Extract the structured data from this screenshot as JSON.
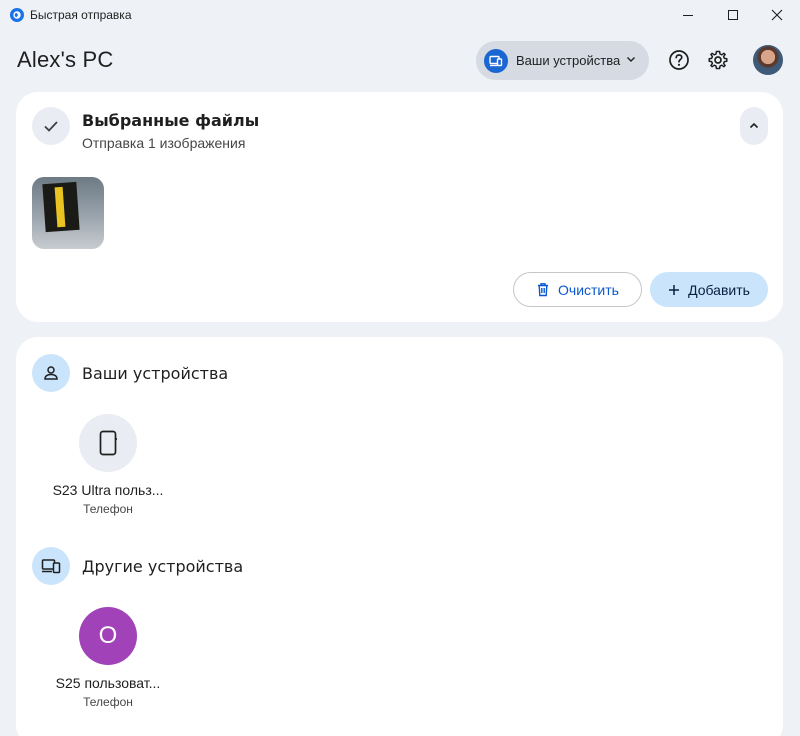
{
  "window": {
    "title": "Быстрая отправка"
  },
  "header": {
    "pc_name": "Alex's PC",
    "devices_pill_label": "Ваши устройства"
  },
  "files_card": {
    "title": "Выбранные файлы",
    "subtitle": "Отправка 1 изображения",
    "clear_label": "Очистить",
    "add_label": "Добавить"
  },
  "devices_card": {
    "your_devices_title": "Ваши устройства",
    "other_devices_title": "Другие устройства",
    "your_devices": [
      {
        "name": "S23 Ultra польз...",
        "type": "Телефон",
        "icon": "phone-icon"
      }
    ],
    "other_devices": [
      {
        "name": "S25 пользоват...",
        "type": "Телефон",
        "initial": "О",
        "color": "#a142b8"
      }
    ]
  },
  "colors": {
    "accent": "#0b57d0",
    "background": "#eef1f6",
    "pill": "#d5dae3",
    "chip_blue": "#c9e4fb",
    "avatar_purple": "#a142b8"
  }
}
